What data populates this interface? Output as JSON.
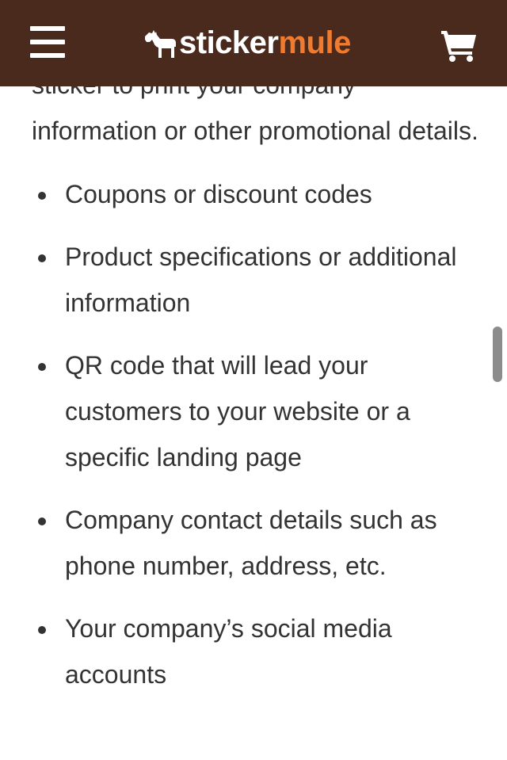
{
  "header": {
    "logo_primary": "sticker",
    "logo_accent": "mule",
    "brand_color": "#4a2a1c",
    "accent_color": "#f07b2e",
    "menu_icon": "hamburger-menu-icon",
    "cart_icon": "shopping-cart-icon"
  },
  "content": {
    "intro_partial": "sticker to print your company",
    "intro": "information or other promotional details.",
    "bullets": [
      "Coupons or discount codes",
      "Product specifications or additional information",
      "QR code that will lead your customers to your website or a specific landing page",
      "Company contact details such as phone number, address, etc.",
      "Your company’s social media accounts"
    ]
  }
}
